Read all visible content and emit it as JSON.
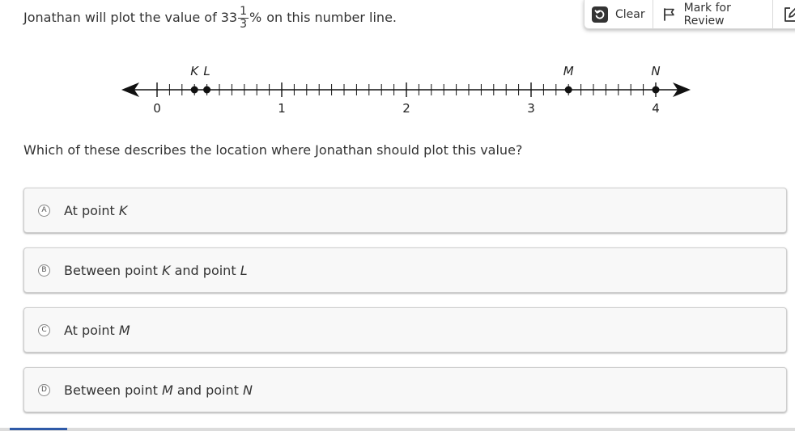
{
  "stem": {
    "before": "Jonathan will plot the value of",
    "whole": "33",
    "numerator": "1",
    "denominator": "3",
    "percent": "%",
    "after": "on this number line."
  },
  "toolbar": {
    "clear_label": "Clear",
    "mark_label": "Mark for Review"
  },
  "number_line": {
    "tick_labels": [
      "0",
      "1",
      "2",
      "3",
      "4"
    ],
    "point_labels": [
      "K",
      "L",
      "M",
      "N"
    ],
    "point_values": [
      0.3,
      0.4,
      3.3,
      4.0
    ],
    "range": [
      0,
      4
    ],
    "minor_divisions": 10
  },
  "prompt": "Which of these describes the location where Jonathan should plot this value?",
  "options": [
    {
      "letter": "A",
      "t1": "At point",
      "v1": "K"
    },
    {
      "letter": "B",
      "t1": "Between point",
      "v1": "K",
      "t2": "and point",
      "v2": "L"
    },
    {
      "letter": "C",
      "t1": "At point",
      "v1": "M"
    },
    {
      "letter": "D",
      "t1": "Between point",
      "v1": "M",
      "t2": "and point",
      "v2": "N"
    }
  ]
}
